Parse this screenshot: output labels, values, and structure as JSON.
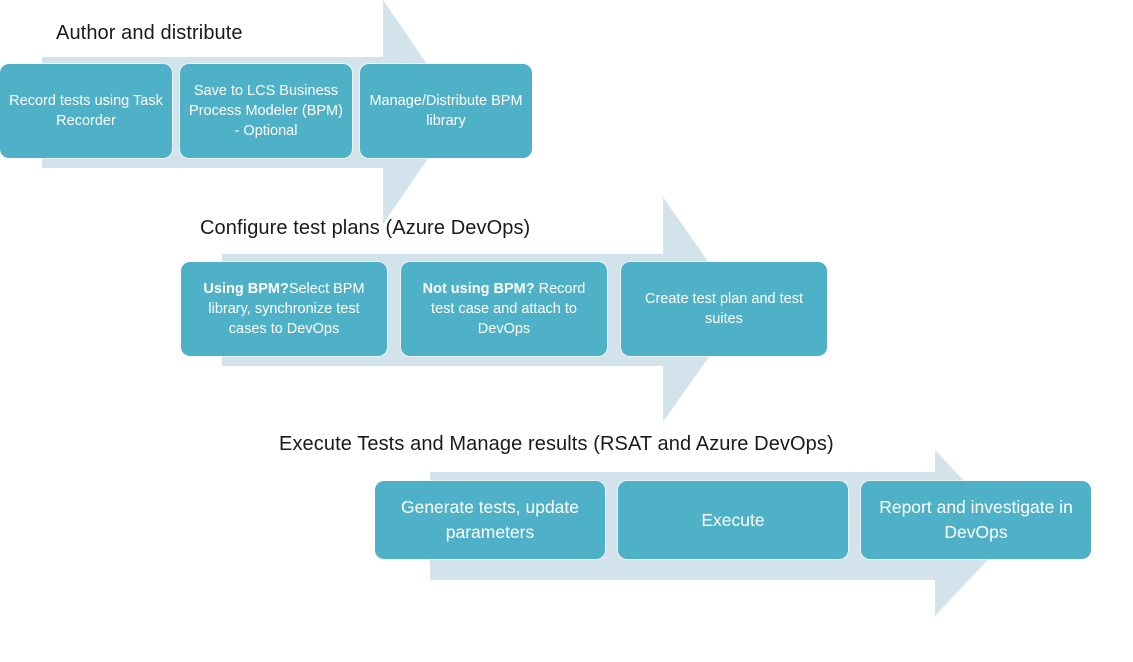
{
  "diagram": {
    "title": "Author and distribute / Configure test plans / Execute Tests flow",
    "colors": {
      "box_fill": "#4fb1c8",
      "arrow_fill": "#d3e3ec",
      "box_text": "#ffffff",
      "title_text": "#1a1a1a",
      "background": "#ffffff"
    }
  },
  "stages": [
    {
      "id": "author-and-distribute",
      "title": "Author and distribute",
      "boxes": [
        {
          "id": "record-tests",
          "text": "Record tests using Task Recorder",
          "bold_prefix": ""
        },
        {
          "id": "save-to-lcs-bpm",
          "text": "Save to LCS Business Process Modeler (BPM) - Optional",
          "bold_prefix": ""
        },
        {
          "id": "manage-distribute-bpm",
          "text": "Manage/Distribute BPM library",
          "bold_prefix": ""
        }
      ]
    },
    {
      "id": "configure-test-plans",
      "title": "Configure test plans (Azure DevOps)",
      "boxes": [
        {
          "id": "using-bpm",
          "bold_prefix": "Using BPM?",
          "text": "Select BPM library, synchronize test cases to DevOps"
        },
        {
          "id": "not-using-bpm",
          "bold_prefix": "Not using BPM?",
          "text": " Record test case and attach to DevOps"
        },
        {
          "id": "create-test-plan",
          "bold_prefix": "",
          "text": "Create test plan and test suites"
        }
      ]
    },
    {
      "id": "execute-tests-and-manage-results",
      "title": "Execute Tests and Manage results (RSAT and Azure DevOps)",
      "boxes": [
        {
          "id": "generate-tests",
          "bold_prefix": "",
          "text": "Generate tests, update parameters"
        },
        {
          "id": "execute",
          "bold_prefix": "",
          "text": "Execute"
        },
        {
          "id": "report-investigate",
          "bold_prefix": "",
          "text": "Report and investigate in DevOps"
        }
      ]
    }
  ]
}
